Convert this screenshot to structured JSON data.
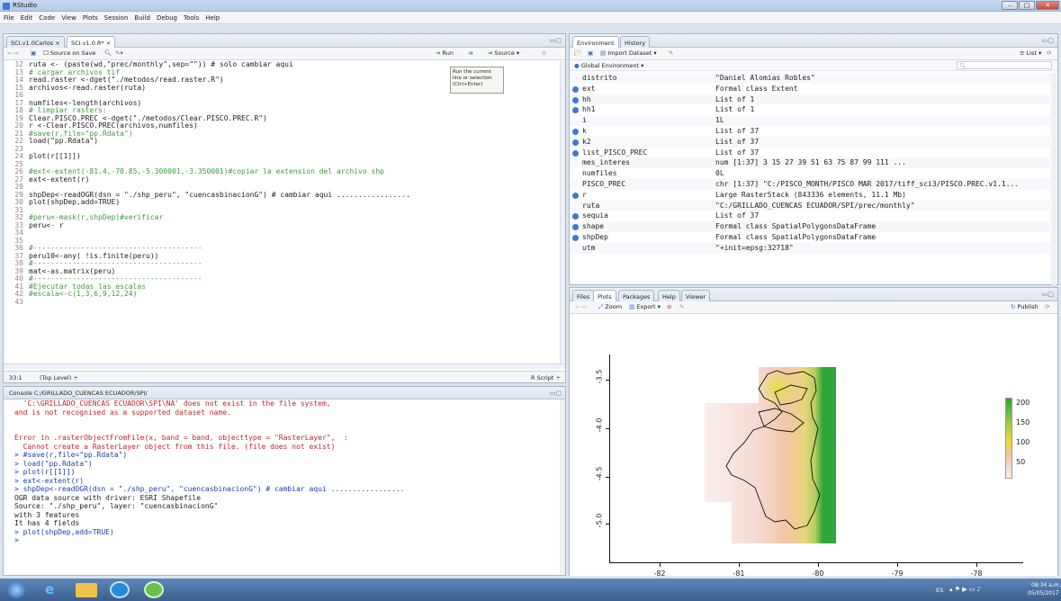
{
  "window": {
    "title": "RStudio"
  },
  "menu": [
    "File",
    "Edit",
    "Code",
    "View",
    "Plots",
    "Session",
    "Build",
    "Debug",
    "Tools",
    "Help"
  ],
  "source": {
    "tabs": [
      "SCI.v1.0Carlos ×",
      "SCI.v1.0.R* ×"
    ],
    "toolbar": {
      "source_on_save": "Source on Save",
      "run": "Run",
      "source": "Source"
    },
    "tooltip": [
      "Run the current",
      "line or selection",
      "(Ctrl+Enter)"
    ],
    "lines": [
      {
        "n": "12",
        "t": "ruta <- (paste(wd,\"prec/monthly\",sep=\"\")) # solo cambiar aqui"
      },
      {
        "n": "13",
        "t": "# cargar archivos tif"
      },
      {
        "n": "14",
        "t": "read.raster <-dget(\"./metodos/read.raster.R\")"
      },
      {
        "n": "15",
        "t": "archivos<-read.raster(ruta)"
      },
      {
        "n": "16",
        "t": ""
      },
      {
        "n": "17",
        "t": "numfiles<-length(archivos)"
      },
      {
        "n": "18",
        "t": "# limpiar rasters:"
      },
      {
        "n": "19",
        "t": "Clear.PISCO.PREC <-dget(\"./metodos/Clear.PISCO.PREC.R\")"
      },
      {
        "n": "20",
        "t": "r <-Clear.PISCO.PREC(archivos,numfiles)"
      },
      {
        "n": "21",
        "t": "#save(r,file=\"pp.Rdata\")"
      },
      {
        "n": "22",
        "t": "load(\"pp.Rdata\")"
      },
      {
        "n": "23",
        "t": ""
      },
      {
        "n": "24",
        "t": "plot(r[[1]])"
      },
      {
        "n": "25",
        "t": ""
      },
      {
        "n": "26",
        "t": "#ext<-extent(-81.4,-78.85,-5.300001,-3.350001)#copiar la extension del archivo shp"
      },
      {
        "n": "27",
        "t": "ext<-extent(r)"
      },
      {
        "n": "28",
        "t": ""
      },
      {
        "n": "29",
        "t": "shpDep<-readOGR(dsn = \"./shp_peru\", \"cuencasbinacionG\") # cambiar aqui ................."
      },
      {
        "n": "30",
        "t": "plot(shpDep,add=TRUE)"
      },
      {
        "n": "31",
        "t": ""
      },
      {
        "n": "32",
        "t": "#peru<-mask(r,shpDep)#verificar"
      },
      {
        "n": "33",
        "t": "peru<- r"
      },
      {
        "n": "34",
        "t": ""
      },
      {
        "n": "35",
        "t": ""
      },
      {
        "n": "36",
        "t": "#---------------------------------------"
      },
      {
        "n": "37",
        "t": "peru10<-any( !is.finite(peru))"
      },
      {
        "n": "38",
        "t": "#---------------------------------------"
      },
      {
        "n": "39",
        "t": "mat<-as.matrix(peru)"
      },
      {
        "n": "40",
        "t": "#---------------------------------------"
      },
      {
        "n": "41",
        "t": "#Ejecutar todas las escalas"
      },
      {
        "n": "42",
        "t": "#escala<-c(1,3,6,9,12,24)"
      },
      {
        "n": "43",
        "t": ""
      }
    ],
    "status": {
      "pos": "33:1",
      "scope": "(Top Level) ÷",
      "type": "R Script ÷"
    }
  },
  "console": {
    "title": "Console C:/GRILLADO_CUENCAS ECUADOR/SPI/",
    "lines": [
      {
        "c": "err",
        "t": "  'C:\\GRILLADO_CUENCAS ECUADOR\\SPI\\NA' does not exist in the file system,"
      },
      {
        "c": "err",
        "t": "and is not recognised as a supported dataset name."
      },
      {
        "c": "",
        "t": ""
      },
      {
        "c": "",
        "t": ""
      },
      {
        "c": "err",
        "t": "Error in .rasterObjectFromFile(x, band = band, objecttype = \"RasterLayer\",  :"
      },
      {
        "c": "err",
        "t": "  Cannot create a RasterLayer object from this file. (file does not exist)"
      },
      {
        "c": "cmd",
        "t": "> #save(r,file=\"pp.Rdata\")"
      },
      {
        "c": "cmd",
        "t": "> load(\"pp.Rdata\")"
      },
      {
        "c": "cmd",
        "t": "> plot(r[[1]])"
      },
      {
        "c": "cmd",
        "t": "> ext<-extent(r)"
      },
      {
        "c": "cmd",
        "t": "> shpDep<-readOGR(dsn = \"./shp_peru\", \"cuencasbinacionG\") # cambiar aqui ................."
      },
      {
        "c": "",
        "t": "OGR data source with driver: ESRI Shapefile"
      },
      {
        "c": "",
        "t": "Source: \"./shp_peru\", layer: \"cuencasbinacionG\""
      },
      {
        "c": "",
        "t": "with 3 features"
      },
      {
        "c": "",
        "t": "It has 4 fields"
      },
      {
        "c": "cmd",
        "t": "> plot(shpDep,add=TRUE)"
      },
      {
        "c": "cmd",
        "t": ">"
      }
    ]
  },
  "environment": {
    "tabs": [
      "Environment",
      "History"
    ],
    "import": "Import Dataset",
    "list": "List",
    "scope": "Global Environment",
    "rows": [
      {
        "n": "distrito",
        "v": "\"Daniel Alomias Robles\"",
        "d": false
      },
      {
        "n": "ext",
        "v": "Formal class Extent",
        "d": true
      },
      {
        "n": "hh",
        "v": "List of 1",
        "d": true
      },
      {
        "n": "hh1",
        "v": "List of 1",
        "d": true
      },
      {
        "n": "i",
        "v": "1L",
        "d": false
      },
      {
        "n": "k",
        "v": "List of 37",
        "d": true
      },
      {
        "n": "k2",
        "v": "List of 37",
        "d": true
      },
      {
        "n": "list_PISCO_PREC",
        "v": "List of 37",
        "d": true
      },
      {
        "n": "mes_interes",
        "v": "num [1:37] 3 15 27 39 51 63 75 87 99 111 ...",
        "d": false
      },
      {
        "n": "numfiles",
        "v": "0L",
        "d": false
      },
      {
        "n": "PISCO_PREC",
        "v": "chr [1:37] \"C:/PISCO_MONTH/PISCO MAR 2017/tiff_sci3/PISCO.PREC.v1.1...",
        "d": false
      },
      {
        "n": "r",
        "v": "Large RasterStack (843336 elements, 11.1 Mb)",
        "d": true
      },
      {
        "n": "ruta",
        "v": "\"C:/GRILLADO_CUENCAS ECUADOR/SPI/prec/monthly\"",
        "d": false
      },
      {
        "n": "sequia",
        "v": "List of 37",
        "d": true
      },
      {
        "n": "shape",
        "v": "Formal class SpatialPolygonsDataFrame",
        "d": true
      },
      {
        "n": "shpDep",
        "v": "Formal class SpatialPolygonsDataFrame",
        "d": true
      },
      {
        "n": "utm",
        "v": "\"+init=epsg:32718\"",
        "d": false
      }
    ]
  },
  "files": {
    "tabs": [
      "Files",
      "Plots",
      "Packages",
      "Help",
      "Viewer"
    ],
    "zoom": "Zoom",
    "export": "Export",
    "publish": "Publish"
  },
  "plot": {
    "xticks": [
      "-82",
      "-81",
      "-80",
      "-79",
      "-78"
    ],
    "yticks": [
      "-3.5",
      "-4.0",
      "-4.5",
      "-5.0"
    ],
    "legend": [
      "200",
      "150",
      "100",
      "50"
    ]
  },
  "taskbar": {
    "lang": "ES",
    "time": "08:34 a.m.",
    "date": "05/05/2017"
  }
}
